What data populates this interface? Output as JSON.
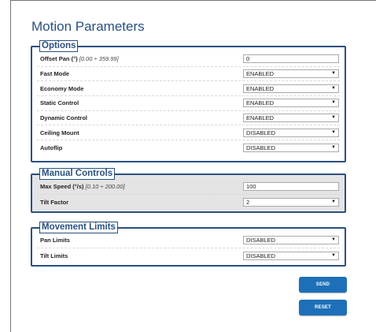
{
  "page": {
    "title": "Motion Parameters"
  },
  "options": {
    "legend": "Options",
    "rows": [
      {
        "label": "Offset Pan (°)",
        "range": "[0.00 ÷ 359.99]",
        "value": "0",
        "type": "input"
      },
      {
        "label": "Fast Mode",
        "value": "ENABLED",
        "type": "select"
      },
      {
        "label": "Economy Mode",
        "value": "ENABLED",
        "type": "select"
      },
      {
        "label": "Static Control",
        "value": "ENABLED",
        "type": "select"
      },
      {
        "label": "Dynamic Control",
        "value": "ENABLED",
        "type": "select"
      },
      {
        "label": "Ceiling Mount",
        "value": "DISABLED",
        "type": "select"
      },
      {
        "label": "Autoflip",
        "value": "DISABLED",
        "type": "select"
      }
    ]
  },
  "manual": {
    "legend": "Manual Controls",
    "rows": [
      {
        "label": "Max Speed (°/s)",
        "range": "[0.10 ÷ 200.00]",
        "value": "100",
        "type": "input"
      },
      {
        "label": "Tilt Factor",
        "value": "2",
        "type": "select"
      }
    ]
  },
  "movement": {
    "legend": "Movement Limits",
    "rows": [
      {
        "label": "Pan Limits",
        "value": "DISABLED",
        "type": "select"
      },
      {
        "label": "Tilt Limits",
        "value": "DISABLED",
        "type": "select"
      }
    ]
  },
  "buttons": {
    "send": "SEND",
    "reset": "RESET"
  },
  "icons": {
    "dropdown": "chevron-down-icon"
  },
  "colors": {
    "accent": "#2a5080",
    "button": "#1d70b8"
  }
}
